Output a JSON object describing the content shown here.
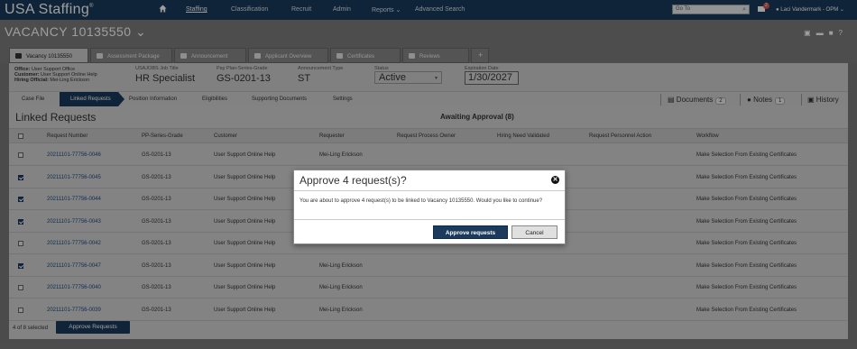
{
  "app": {
    "logo": "USA Staffing",
    "logo_mark": "®"
  },
  "nav": {
    "items": [
      "Staffing",
      "Classification",
      "Recruit",
      "Admin",
      "Reports",
      "Advanced Search"
    ],
    "reports_caret": "⌄",
    "goto_placeholder": "Go To",
    "mail_badge": "2",
    "user": "Laci Vandermark - OPM ⌄"
  },
  "vacancy": {
    "title": "VACANCY 10135550",
    "caret": "⌄"
  },
  "tabs": [
    "Vacancy 10135550",
    "Assessment Package",
    "Announcement",
    "Applicant Overview",
    "Certificates",
    "Reviews",
    "+"
  ],
  "info": {
    "office_label": "Office:",
    "office": "User Support Office",
    "customer_label": "Customer:",
    "customer": "User Support Online Help",
    "hiring_label": "Hiring Official:",
    "hiring": "Mei-Ling Erickson",
    "job_title_label": "USAJOBS Job Title",
    "job_title": "HR Specialist",
    "pps_label": "Pay Plan-Series-Grade",
    "pps": "GS-0201-13",
    "ann_type_label": "Announcement Type",
    "ann_type": "ST",
    "status_label": "Status",
    "status": "Active",
    "exp_label": "Expiration Date",
    "exp": "1/30/2027"
  },
  "crumbs": [
    "Case File",
    "Linked Requests",
    "Position Information",
    "Eligibilities",
    "Supporting Documents",
    "Settings"
  ],
  "side": {
    "documents": "Documents",
    "documents_count": "2",
    "notes": "Notes",
    "notes_count": "1",
    "history": "History"
  },
  "main": {
    "title": "Linked Requests",
    "awaiting": "Awaiting Approval (8)",
    "columns": [
      "Request Number",
      "PP-Series-Grade",
      "Customer",
      "Requester",
      "Request Process Owner",
      "Hiring Need Validated",
      "Request Personnel Action",
      "Workflow"
    ],
    "rows": [
      {
        "num": "20211101-77756-0046",
        "pps": "GS-0201-13",
        "customer": "User Support Online Help",
        "requester": "Mei-Ling Erickson",
        "workflow": "Make Selection From Existing Certificates",
        "checked": false
      },
      {
        "num": "20211101-77756-0045",
        "pps": "GS-0201-13",
        "customer": "User Support Online Help",
        "requester": "",
        "workflow": "Make Selection From Existing Certificates",
        "checked": true
      },
      {
        "num": "20211101-77756-0044",
        "pps": "GS-0201-13",
        "customer": "User Support Online Help",
        "requester": "",
        "workflow": "Make Selection From Existing Certificates",
        "checked": true
      },
      {
        "num": "20211101-77756-0043",
        "pps": "GS-0201-13",
        "customer": "User Support Online Help",
        "requester": "",
        "workflow": "Make Selection From Existing Certificates",
        "checked": true
      },
      {
        "num": "20211101-77756-0042",
        "pps": "GS-0201-13",
        "customer": "User Support Online Help",
        "requester": "",
        "workflow": "Make Selection From Existing Certificates",
        "checked": false
      },
      {
        "num": "20211101-77756-0047",
        "pps": "GS-0201-13",
        "customer": "User Support Online Help",
        "requester": "Mei-Ling Erickson",
        "workflow": "Make Selection From Existing Certificates",
        "checked": true
      },
      {
        "num": "20211101-77756-0040",
        "pps": "GS-0201-13",
        "customer": "User Support Online Help",
        "requester": "Mei-Ling Erickson",
        "workflow": "Make Selection From Existing Certificates",
        "checked": false
      },
      {
        "num": "20211101-77756-0039",
        "pps": "GS-0201-13",
        "customer": "User Support Online Help",
        "requester": "Mei-Ling Erickson",
        "workflow": "Make Selection From Existing Certificates",
        "checked": false
      }
    ],
    "selected_count": "4 of 8 selected",
    "approve_button": "Approve Requests"
  },
  "modal": {
    "title": "Approve 4 request(s)?",
    "close": "✕",
    "body": "You are about to approve 4 request(s) to be linked to Vacancy 10135550. Would you like to continue?",
    "approve": "Approve requests",
    "cancel": "Cancel"
  },
  "colors": {
    "navy": "#1b3a5c",
    "overlay": "rgba(0,0,0,0.38)"
  }
}
